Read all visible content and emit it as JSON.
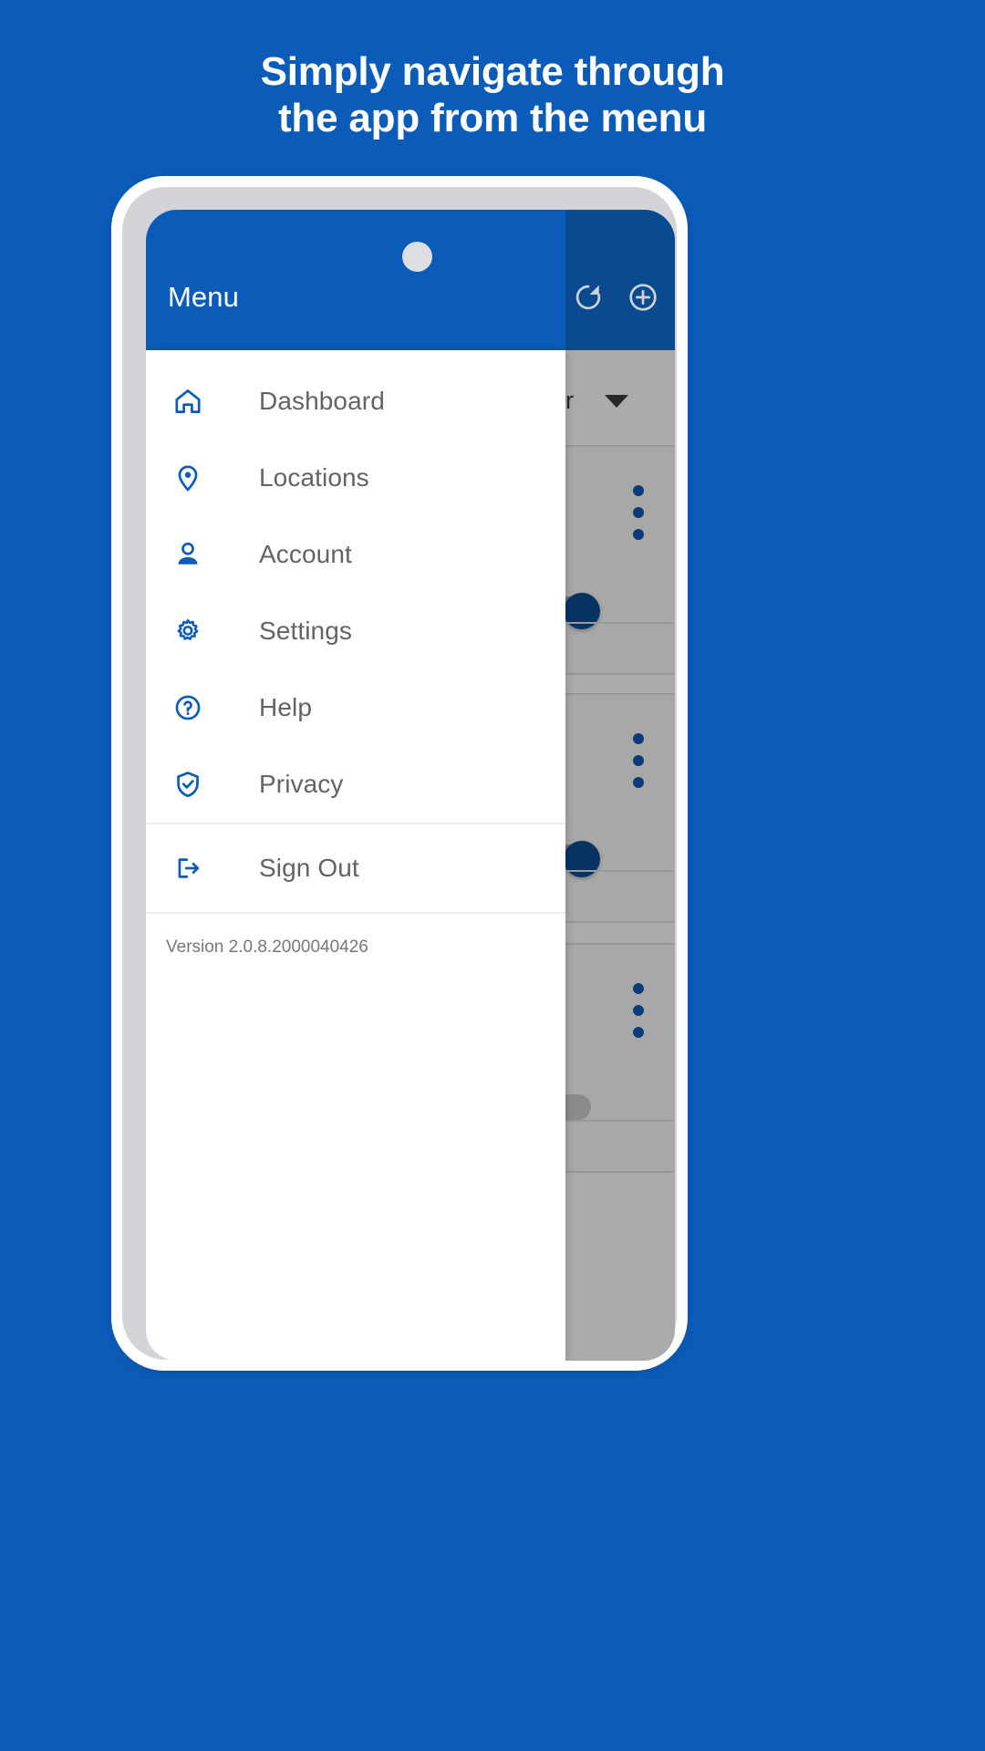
{
  "headline": {
    "line1": "Simply navigate through",
    "line2": "the app from the menu"
  },
  "colors": {
    "background": "#0B5CB8",
    "appbar": "#0B5CB8",
    "appbar_dim": "#0A4A90",
    "accent": "#0B5CB8",
    "toggle_on_thumb": "#0B4D94",
    "menu_label": "#636363"
  },
  "appbar": {
    "title": "Menu",
    "actions": [
      {
        "name": "refresh-icon",
        "label": "Refresh"
      },
      {
        "name": "add-circle-icon",
        "label": "Add"
      }
    ]
  },
  "drawer": {
    "items": [
      {
        "icon": "home-icon",
        "label": "Dashboard"
      },
      {
        "icon": "location-pin-icon",
        "label": "Locations"
      },
      {
        "icon": "person-icon",
        "label": "Account"
      },
      {
        "icon": "gear-icon",
        "label": "Settings"
      },
      {
        "icon": "question-circle-icon",
        "label": "Help"
      },
      {
        "icon": "shield-check-icon",
        "label": "Privacy"
      }
    ],
    "sign_out": {
      "icon": "sign-out-icon",
      "label": "Sign Out"
    },
    "version": "Version 2.0.8.2000040426"
  },
  "background_content": {
    "sort_dropdown": {
      "label": "Order",
      "icon": "chevron-down-icon"
    },
    "cards": [
      {
        "menu_icon": "more-vertical-icon",
        "toggle_state": "on"
      },
      {
        "menu_icon": "more-vertical-icon",
        "toggle_state": "on"
      },
      {
        "menu_icon": "more-vertical-icon",
        "toggle_state": "off"
      }
    ]
  }
}
